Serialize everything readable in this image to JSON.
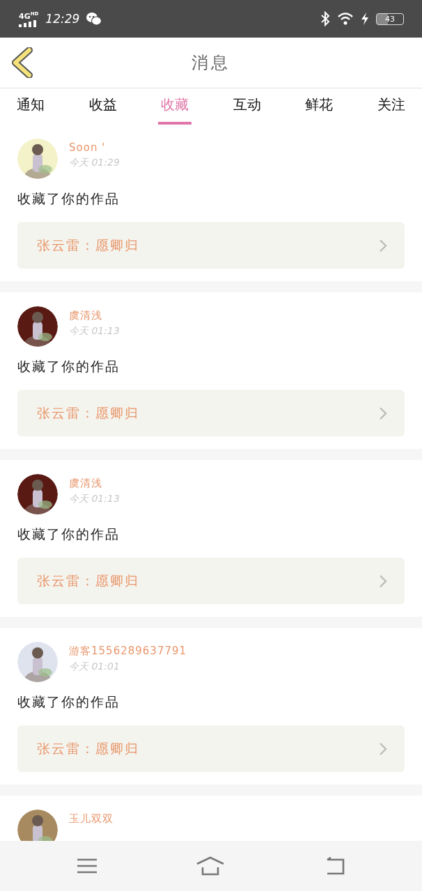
{
  "status_bar": {
    "network": "4G",
    "network_badge": "HD",
    "time": "12:29",
    "battery": "43"
  },
  "header": {
    "title": "消息"
  },
  "tabs": [
    {
      "label": "通知",
      "selected": false
    },
    {
      "label": "收益",
      "selected": false
    },
    {
      "label": "收藏",
      "selected": true
    },
    {
      "label": "互动",
      "selected": false
    },
    {
      "label": "鲜花",
      "selected": false
    },
    {
      "label": "关注",
      "selected": false
    }
  ],
  "messages": [
    {
      "name": "Soon '",
      "time": "今天 01:29",
      "text": "收藏了你的作品",
      "work": "张云雷：愿卿归"
    },
    {
      "name": "虞清浅",
      "time": "今天 01:13",
      "text": "收藏了你的作品",
      "work": "张云雷：愿卿归"
    },
    {
      "name": "虞清浅",
      "time": "今天 01:13",
      "text": "收藏了你的作品",
      "work": "张云雷：愿卿归"
    },
    {
      "name": "游客1556289637791",
      "time": "今天 01:01",
      "text": "收藏了你的作品",
      "work": "张云雷：愿卿归"
    },
    {
      "name": "玉儿双双"
    }
  ]
}
